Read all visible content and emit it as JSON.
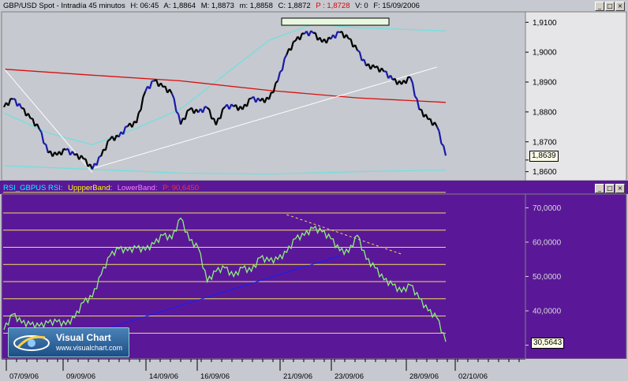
{
  "top_header": {
    "symbol": "GBP/USD Spot - Intradía 45 minutos",
    "h": "H: 06:45",
    "a": "A: 1,8864",
    "m1": "M: 1,8873",
    "m2": "m: 1,8858",
    "c": "C: 1,8872",
    "p": "P : 1,8728",
    "v": "V: 0",
    "f": "F: 15/09/2006"
  },
  "bottom_header": {
    "rsi": "RSI_GBPUS RSI:",
    "upper": "UppperBand:",
    "lower": "LowerBand:",
    "p": "P: 90,6450"
  },
  "window_buttons": {
    "minimize": "_",
    "maximize": "□",
    "close": "×"
  },
  "price_tag": "1,8639",
  "rsi_tag": "30,5643",
  "logo": {
    "name": "Visual Chart",
    "url": "www.visualchart.com"
  },
  "colors": {
    "price_bg": "#c6c9cf",
    "rsi_bg": "#5a1898",
    "candles_dark": "#000000",
    "candles_blue": "#1a1aa8",
    "ma_red": "#d81010",
    "band_cyan": "#6ee0e0",
    "trend_white": "#ffffff",
    "rsi_line": "#8cf07a",
    "rsi_levels": "#f0e060",
    "rsi_trend_blue": "#1020ff",
    "rsi_trend_yellow": "#f0e060"
  },
  "chart_data": [
    {
      "type": "line",
      "title": "GBP/USD Spot - Intradía 45 minutos",
      "y_axis": {
        "ticks": [
          "1,9100",
          "1,9000",
          "1,8900",
          "1,8800",
          "1,8700",
          "1,8600"
        ],
        "ylim": [
          1.857,
          1.9135
        ]
      },
      "x": [
        0,
        4,
        8,
        12,
        16,
        20,
        24,
        28,
        32,
        36,
        40,
        44,
        48,
        52,
        56,
        60,
        64,
        68,
        72,
        76,
        80,
        84,
        88,
        92,
        96,
        100,
        104,
        108,
        112,
        116,
        120,
        124,
        128,
        132,
        136,
        140,
        144,
        148,
        152,
        156,
        160,
        164,
        168,
        172,
        176,
        180,
        184,
        188,
        192,
        196,
        200
      ],
      "series": [
        {
          "name": "",
          "values": [
            1.8816,
            1.8843,
            1.8812,
            1.8778,
            1.8743,
            1.8663,
            1.8655,
            1.8673,
            1.8655,
            1.8643,
            1.8608,
            1.8652,
            1.8708,
            1.8716,
            1.8751,
            1.8763,
            1.8868,
            1.8904,
            1.8883,
            1.8862,
            1.8758,
            1.8808,
            1.8798,
            1.8814,
            1.8756,
            1.8816,
            1.8818,
            1.8808,
            1.8845,
            1.8836,
            1.8842,
            1.8904,
            1.8992,
            1.9038,
            1.9061,
            1.9064,
            1.9033,
            1.9044,
            1.9066,
            1.9045,
            1.9006,
            1.8954,
            1.8948,
            1.8935,
            1.8907,
            1.8892,
            1.8915,
            1.8808,
            1.8775,
            1.8751,
            1.8654
          ]
        }
      ],
      "moving_average": [
        [
          0,
          1.8943
        ],
        [
          40,
          1.8923
        ],
        [
          80,
          1.8904
        ],
        [
          120,
          1.8872
        ],
        [
          160,
          1.8847
        ],
        [
          200,
          1.8832
        ]
      ],
      "upper_band": [
        [
          0,
          1.8796
        ],
        [
          20,
          1.873
        ],
        [
          40,
          1.869
        ],
        [
          60,
          1.8745
        ],
        [
          80,
          1.881
        ],
        [
          120,
          1.904
        ],
        [
          140,
          1.9094
        ],
        [
          160,
          1.9082
        ],
        [
          200,
          1.9071
        ]
      ],
      "lower_band": [
        [
          0,
          1.862
        ],
        [
          40,
          1.8608
        ],
        [
          80,
          1.8595
        ],
        [
          120,
          1.8592
        ],
        [
          160,
          1.86
        ],
        [
          200,
          1.8605
        ]
      ],
      "trendlines": [
        {
          "name": "",
          "from": [
            0,
            1.8945
          ],
          "to": [
            40,
            1.8597
          ]
        },
        {
          "name": "",
          "from": [
            40,
            1.861
          ],
          "to": [
            196,
            1.895
          ]
        }
      ],
      "last_price": "1,8639"
    },
    {
      "type": "line",
      "title": "RSI_GBPUS",
      "y_axis": {
        "ticks": [
          "70,0000",
          "60,0000",
          "50,0000",
          "40,0000",
          "30,0000"
        ],
        "ylim": [
          26,
          74
        ],
        "levels": [
          74.5,
          68.5,
          63.5,
          58.5,
          53.5,
          48.5,
          43.5,
          38.5,
          33.5
        ]
      },
      "x": [
        0,
        4,
        8,
        12,
        16,
        20,
        24,
        28,
        32,
        36,
        40,
        44,
        48,
        52,
        56,
        60,
        64,
        68,
        72,
        76,
        80,
        84,
        88,
        92,
        96,
        100,
        104,
        108,
        112,
        116,
        120,
        124,
        128,
        132,
        136,
        140,
        144,
        148,
        152,
        156,
        160,
        164,
        168,
        172,
        176,
        180,
        184,
        188,
        192,
        196,
        200
      ],
      "series": [
        {
          "name": "",
          "values": [
            34.5,
            39,
            36.5,
            36,
            35.5,
            36.5,
            36.8,
            36,
            38,
            42.5,
            44,
            50.5,
            56,
            58,
            57.5,
            58.3,
            57.7,
            59.5,
            62,
            61,
            67,
            60.5,
            58.3,
            48.5,
            51.5,
            52.5,
            50,
            52.5,
            51.5,
            55.5,
            54.5,
            55,
            57,
            61,
            62,
            64,
            63,
            61,
            57.5,
            57,
            62,
            55,
            52.5,
            49,
            47.5,
            45.5,
            47.5,
            43.5,
            40,
            38,
            31
          ]
        }
      ],
      "trendlines": [
        {
          "name": "",
          "from": [
            40,
            33.5
          ],
          "to": [
            152,
            56
          ]
        },
        {
          "name": "",
          "from": [
            128,
            68
          ],
          "to": [
            180,
            56.5
          ]
        }
      ],
      "last_value": "30,5643"
    }
  ],
  "x_axis_labels": [
    "07/09/06",
    "09/09/06",
    "14/09/06",
    "16/09/06",
    "21/09/06",
    "23/09/06",
    "28/09/06",
    "02/10/06"
  ]
}
